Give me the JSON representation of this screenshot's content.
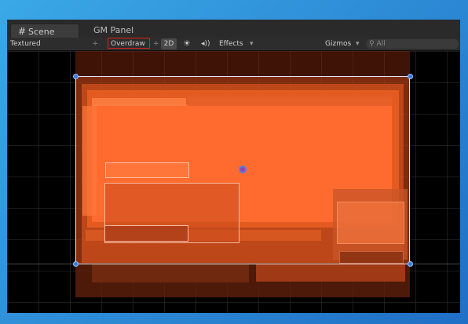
{
  "tabs": [
    {
      "label": "Scene",
      "icon": "hash-icon",
      "active": true
    },
    {
      "label": "GM Panel",
      "active": false
    }
  ],
  "toolbar": {
    "shading_mode": "Textured",
    "render_mode": "Overdraw",
    "render_mode_highlight": "#e0201a",
    "mode_2d": "2D",
    "lighting_icon": "sun-icon",
    "audio_icon": "speaker-icon",
    "effects_label": "Effects",
    "gizmos_label": "Gizmos",
    "search_placeholder": "All",
    "search_icon": "search-icon"
  },
  "colors": {
    "overdraw": "#ff6a2e",
    "selection_outline": "#e8e8e8",
    "handle": "#3b7bd8"
  }
}
